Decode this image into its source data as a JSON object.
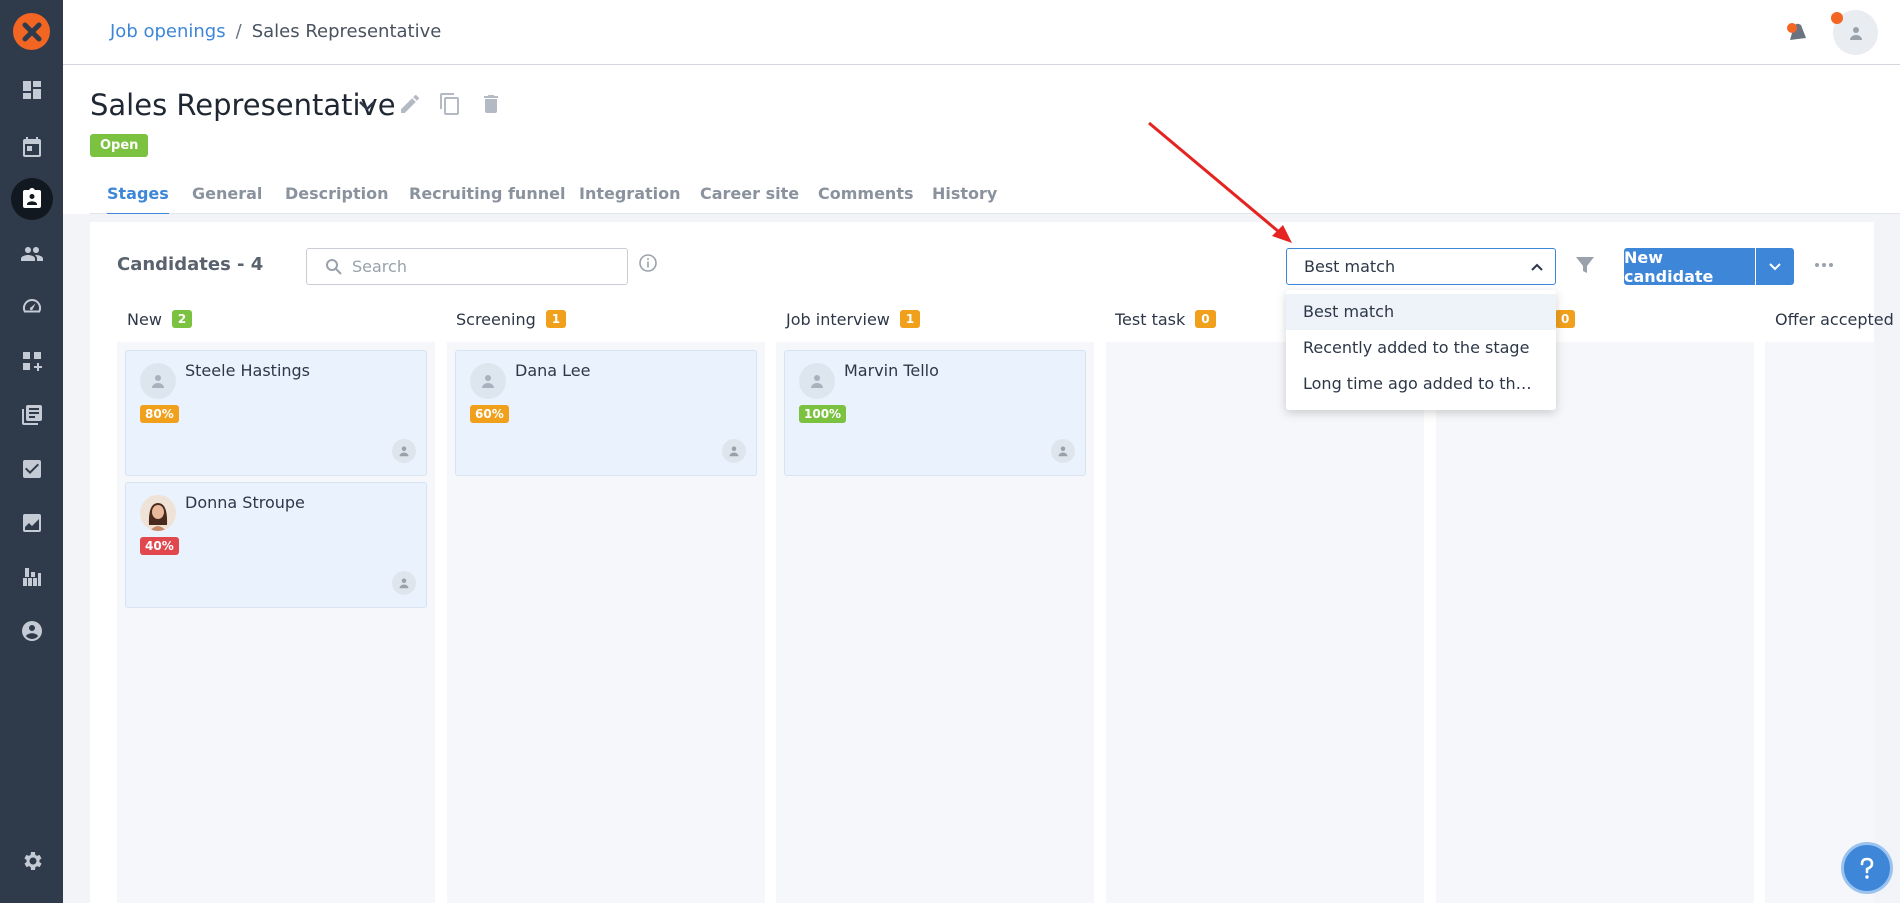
{
  "breadcrumb": {
    "parent": "Job openings",
    "separator": "/",
    "current": "Sales Representative"
  },
  "job": {
    "title": "Sales Representative",
    "status": "Open"
  },
  "tabs": [
    {
      "label": "Stages",
      "active": true
    },
    {
      "label": "General"
    },
    {
      "label": "Description"
    },
    {
      "label": "Recruiting funnel"
    },
    {
      "label": "Integration"
    },
    {
      "label": "Career site"
    },
    {
      "label": "Comments"
    },
    {
      "label": "History"
    }
  ],
  "toolbar": {
    "candidates_label": "Candidates - 4",
    "search_placeholder": "Search",
    "sort_value": "Best match",
    "new_candidate": "New candidate"
  },
  "sort_menu": {
    "options": [
      "Best match",
      "Recently added to the stage",
      "Long time ago added to the sta..."
    ],
    "selected": "Best match"
  },
  "columns": [
    {
      "name": "New",
      "count": "2"
    },
    {
      "name": "Screening",
      "count": "1"
    },
    {
      "name": "Job interview",
      "count": "1"
    },
    {
      "name": "Test task",
      "count": "0"
    },
    {
      "name": "",
      "count": "0"
    },
    {
      "name": "Offer accepted",
      "count": ""
    }
  ],
  "candidates": [
    {
      "name": "Steele Hastings",
      "score": "80%",
      "score_color": "#f0a01b"
    },
    {
      "name": "Donna Stroupe",
      "score": "40%",
      "score_color": "#e0484e"
    },
    {
      "name": "Dana Lee",
      "score": "60%",
      "score_color": "#f0a01b"
    },
    {
      "name": "Marvin Tello",
      "score": "100%",
      "score_color": "#7cc241"
    }
  ],
  "colors": {
    "accent": "#3d86d8",
    "brand": "#f26522",
    "sidebar": "#2f3a4a",
    "annotation": "#e52421"
  }
}
